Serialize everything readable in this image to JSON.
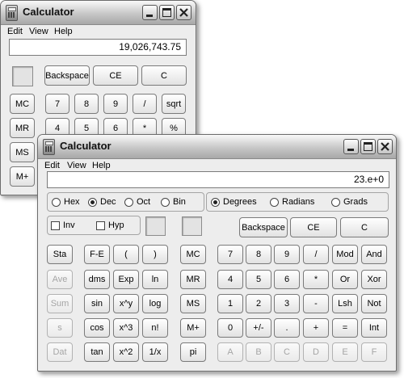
{
  "standard": {
    "title": "Calculator",
    "menu": [
      "Edit",
      "View",
      "Help"
    ],
    "display": "19,026,743.75",
    "control_buttons": [
      "Backspace",
      "CE",
      "C"
    ],
    "memory_buttons": [
      "MC",
      "MR",
      "MS",
      "M+"
    ],
    "row1": [
      "7",
      "8",
      "9",
      "/",
      "sqrt"
    ],
    "row2": [
      "4",
      "5",
      "6",
      "*",
      "%"
    ]
  },
  "scientific": {
    "title": "Calculator",
    "menu": [
      "Edit",
      "View",
      "Help"
    ],
    "display": "23.e+0",
    "base_options": [
      "Hex",
      "Dec",
      "Oct",
      "Bin"
    ],
    "base_selected": "Dec",
    "angle_options": [
      "Degrees",
      "Radians",
      "Grads"
    ],
    "angle_selected": "Degrees",
    "checkboxes": [
      "Inv",
      "Hyp"
    ],
    "control_buttons": [
      "Backspace",
      "CE",
      "C"
    ],
    "stat_buttons": [
      "Sta",
      "Ave",
      "Sum",
      "s",
      "Dat"
    ],
    "func_col1": [
      "F-E",
      "dms",
      "sin",
      "cos",
      "tan"
    ],
    "func_col2": [
      "(",
      "Exp",
      "x^y",
      "x^3",
      "x^2"
    ],
    "func_col3": [
      ")",
      "ln",
      "log",
      "n!",
      "1/x"
    ],
    "memory_buttons": [
      "MC",
      "MR",
      "MS",
      "M+",
      "pi"
    ],
    "digit_rows": [
      [
        "7",
        "8",
        "9",
        "/",
        "Mod",
        "And"
      ],
      [
        "4",
        "5",
        "6",
        "*",
        "Or",
        "Xor"
      ],
      [
        "1",
        "2",
        "3",
        "-",
        "Lsh",
        "Not"
      ],
      [
        "0",
        "+/-",
        ".",
        "+",
        "=",
        "Int"
      ],
      [
        "A",
        "B",
        "C",
        "D",
        "E",
        "F"
      ]
    ]
  }
}
